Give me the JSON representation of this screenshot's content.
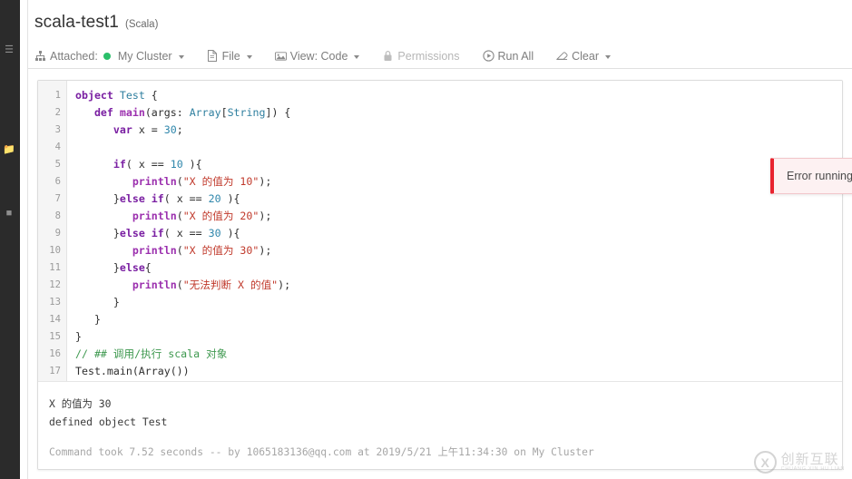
{
  "window": {
    "notebook_title": "scala-test1",
    "notebook_language": "(Scala)"
  },
  "nav_rail": {
    "icons": [
      "menu-icon",
      "folder-icon",
      "workspace-icon"
    ]
  },
  "toolbar": {
    "attached_label": "Attached:",
    "cluster_name": "My Cluster",
    "cluster_status_color": "#2bbf6a",
    "file_label": "File",
    "view_label": "View: Code",
    "permissions_label": "Permissions",
    "run_all_label": "Run All",
    "clear_label": "Clear"
  },
  "error_toast": {
    "message": "Error running",
    "accent_color": "#e8242f",
    "background_color": "#fdf1f2"
  },
  "editor": {
    "language": "scala",
    "lines": [
      {
        "n": "1",
        "tokens": [
          {
            "t": "kw",
            "s": "object"
          },
          {
            "t": "pl",
            "s": " "
          },
          {
            "t": "type",
            "s": "Test"
          },
          {
            "t": "pl",
            "s": " {"
          }
        ]
      },
      {
        "n": "2",
        "tokens": [
          {
            "t": "pl",
            "s": "   "
          },
          {
            "t": "kw",
            "s": "def"
          },
          {
            "t": "pl",
            "s": " "
          },
          {
            "t": "fn",
            "s": "main"
          },
          {
            "t": "pl",
            "s": "(args: "
          },
          {
            "t": "type",
            "s": "Array"
          },
          {
            "t": "pl",
            "s": "["
          },
          {
            "t": "type",
            "s": "String"
          },
          {
            "t": "pl",
            "s": "]) {"
          }
        ]
      },
      {
        "n": "3",
        "tokens": [
          {
            "t": "pl",
            "s": "      "
          },
          {
            "t": "kw",
            "s": "var"
          },
          {
            "t": "pl",
            "s": " x = "
          },
          {
            "t": "num",
            "s": "30"
          },
          {
            "t": "pl",
            "s": ";"
          }
        ]
      },
      {
        "n": "4",
        "tokens": [
          {
            "t": "pl",
            "s": ""
          }
        ]
      },
      {
        "n": "5",
        "tokens": [
          {
            "t": "pl",
            "s": "      "
          },
          {
            "t": "kw",
            "s": "if"
          },
          {
            "t": "pl",
            "s": "( x == "
          },
          {
            "t": "num",
            "s": "10"
          },
          {
            "t": "pl",
            "s": " ){"
          }
        ]
      },
      {
        "n": "6",
        "tokens": [
          {
            "t": "pl",
            "s": "         "
          },
          {
            "t": "fn",
            "s": "println"
          },
          {
            "t": "pl",
            "s": "("
          },
          {
            "t": "str",
            "s": "\"X 的值为 10\""
          },
          {
            "t": "pl",
            "s": ");"
          }
        ]
      },
      {
        "n": "7",
        "tokens": [
          {
            "t": "pl",
            "s": "      }"
          },
          {
            "t": "kw",
            "s": "else if"
          },
          {
            "t": "pl",
            "s": "( x == "
          },
          {
            "t": "num",
            "s": "20"
          },
          {
            "t": "pl",
            "s": " ){"
          }
        ]
      },
      {
        "n": "8",
        "tokens": [
          {
            "t": "pl",
            "s": "         "
          },
          {
            "t": "fn",
            "s": "println"
          },
          {
            "t": "pl",
            "s": "("
          },
          {
            "t": "str",
            "s": "\"X 的值为 20\""
          },
          {
            "t": "pl",
            "s": ");"
          }
        ]
      },
      {
        "n": "9",
        "tokens": [
          {
            "t": "pl",
            "s": "      }"
          },
          {
            "t": "kw",
            "s": "else if"
          },
          {
            "t": "pl",
            "s": "( x == "
          },
          {
            "t": "num",
            "s": "30"
          },
          {
            "t": "pl",
            "s": " ){"
          }
        ]
      },
      {
        "n": "10",
        "tokens": [
          {
            "t": "pl",
            "s": "         "
          },
          {
            "t": "fn",
            "s": "println"
          },
          {
            "t": "pl",
            "s": "("
          },
          {
            "t": "str",
            "s": "\"X 的值为 30\""
          },
          {
            "t": "pl",
            "s": ");"
          }
        ]
      },
      {
        "n": "11",
        "tokens": [
          {
            "t": "pl",
            "s": "      }"
          },
          {
            "t": "kw",
            "s": "else"
          },
          {
            "t": "pl",
            "s": "{"
          }
        ]
      },
      {
        "n": "12",
        "tokens": [
          {
            "t": "pl",
            "s": "         "
          },
          {
            "t": "fn",
            "s": "println"
          },
          {
            "t": "pl",
            "s": "("
          },
          {
            "t": "str",
            "s": "\"无法判断 X 的值\""
          },
          {
            "t": "pl",
            "s": ");"
          }
        ]
      },
      {
        "n": "13",
        "tokens": [
          {
            "t": "pl",
            "s": "      }"
          }
        ]
      },
      {
        "n": "14",
        "tokens": [
          {
            "t": "pl",
            "s": "   }"
          }
        ]
      },
      {
        "n": "15",
        "tokens": [
          {
            "t": "pl",
            "s": "}"
          }
        ]
      },
      {
        "n": "16",
        "tokens": [
          {
            "t": "cmt",
            "s": "// ## 调用/执行 scala 对象"
          }
        ]
      },
      {
        "n": "17",
        "tokens": [
          {
            "t": "pl",
            "s": "Test.main(Array())"
          }
        ]
      }
    ]
  },
  "results": {
    "output_lines": [
      "X 的值为 30",
      "defined object Test"
    ],
    "status_line": "Command took 7.52 seconds -- by 1065183136@qq.com at 2019/5/21 上午11:34:30 on My Cluster"
  },
  "watermark": {
    "mark": "X",
    "chinese": "创新互联",
    "english": "CHUANG XIN HU LIAN"
  }
}
